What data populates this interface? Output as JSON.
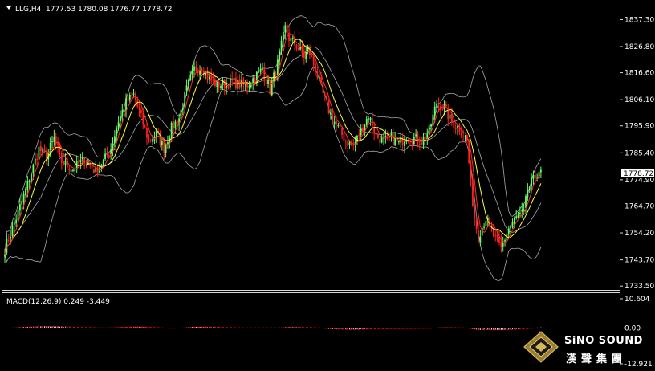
{
  "header": {
    "symbol": "LLG,H4",
    "ohlc": "1777.53 1780.08 1776.77 1778.72",
    "macd_label": "MACD(12,26,9) 0.249 -3.449"
  },
  "price_axis": {
    "ticks": [
      "1837.30",
      "1826.80",
      "1816.60",
      "1806.10",
      "1795.90",
      "1785.40",
      "1774.90",
      "1764.70",
      "1754.20",
      "1743.70",
      "1733.50"
    ],
    "current_price_label": "1778.72"
  },
  "macd_axis": {
    "ticks": [
      "10.604",
      "0.00",
      "-12.921"
    ]
  },
  "logo": {
    "name": "SiNO SOUND",
    "chinese": "漢聲集團"
  },
  "colors": {
    "background": "#000000",
    "bull": "#66ff66",
    "bear": "#ff2020",
    "fast_ma": "#ff2a2a",
    "slow_ma": "#ffff33",
    "bands": "#a6a6a6",
    "macd_hist": "#ffffff",
    "signal": "#ff0000",
    "frame": "#d9d9d9"
  },
  "chart_data": [
    {
      "type": "candlestick",
      "title": "LLG,H4",
      "ylim": [
        1732,
        1844
      ],
      "overlays": [
        "bollinger-bands",
        "fast-moving-average",
        "slow-moving-average"
      ],
      "last_close": 1778.72,
      "anchor_closes": [
        [
          0,
          1748
        ],
        [
          6,
          1760
        ],
        [
          12,
          1773
        ],
        [
          18,
          1787
        ],
        [
          22,
          1784
        ],
        [
          26,
          1791
        ],
        [
          30,
          1782
        ],
        [
          36,
          1779
        ],
        [
          42,
          1783
        ],
        [
          48,
          1778
        ],
        [
          52,
          1782
        ],
        [
          56,
          1787
        ],
        [
          60,
          1798
        ],
        [
          64,
          1805
        ],
        [
          68,
          1808
        ],
        [
          72,
          1799
        ],
        [
          76,
          1790
        ],
        [
          80,
          1793
        ],
        [
          84,
          1787
        ],
        [
          88,
          1795
        ],
        [
          92,
          1799
        ],
        [
          96,
          1810
        ],
        [
          100,
          1818
        ],
        [
          104,
          1819
        ],
        [
          108,
          1814
        ],
        [
          112,
          1812
        ],
        [
          116,
          1812
        ],
        [
          120,
          1813
        ],
        [
          124,
          1812
        ],
        [
          128,
          1812
        ],
        [
          132,
          1815
        ],
        [
          136,
          1818
        ],
        [
          140,
          1810
        ],
        [
          144,
          1820
        ],
        [
          148,
          1834
        ],
        [
          150,
          1830
        ],
        [
          154,
          1827
        ],
        [
          158,
          1823
        ],
        [
          160,
          1826
        ],
        [
          164,
          1818
        ],
        [
          168,
          1808
        ],
        [
          172,
          1800
        ],
        [
          176,
          1795
        ],
        [
          180,
          1790
        ],
        [
          184,
          1788
        ],
        [
          188,
          1794
        ],
        [
          192,
          1800
        ],
        [
          196,
          1792
        ],
        [
          200,
          1790
        ],
        [
          204,
          1791
        ],
        [
          208,
          1789
        ],
        [
          212,
          1792
        ],
        [
          216,
          1791
        ],
        [
          220,
          1790
        ],
        [
          224,
          1794
        ],
        [
          228,
          1805
        ],
        [
          232,
          1803
        ],
        [
          236,
          1797
        ],
        [
          240,
          1795
        ],
        [
          244,
          1790
        ],
        [
          246,
          1773
        ],
        [
          248,
          1760
        ],
        [
          250,
          1753
        ],
        [
          254,
          1760
        ],
        [
          258,
          1753
        ],
        [
          262,
          1748
        ],
        [
          266,
          1756
        ],
        [
          270,
          1760
        ],
        [
          274,
          1762
        ],
        [
          276,
          1771
        ],
        [
          280,
          1776
        ],
        [
          282,
          1778.72
        ]
      ]
    },
    {
      "type": "bar",
      "title": "MACD(12,26,9)",
      "macd_value": 0.249,
      "signal_value": -3.449,
      "ylim": [
        -14.5,
        12.5
      ]
    }
  ]
}
